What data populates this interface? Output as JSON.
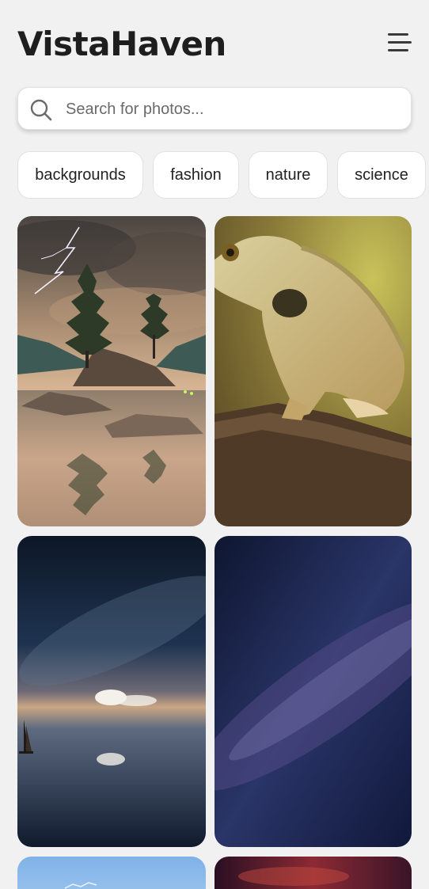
{
  "app": {
    "title": "VistaHaven",
    "menu_icon": "hamburger-menu-icon"
  },
  "search": {
    "placeholder": "Search for photos...",
    "value": "",
    "icon": "search-icon"
  },
  "categories": [
    "backgrounds",
    "fashion",
    "nature",
    "science"
  ],
  "gallery": {
    "photos": [
      {
        "subject": "lakeside trees with lightning"
      },
      {
        "subject": "lizard on a branch"
      },
      {
        "subject": "starry sky reflected over water with sailboat"
      },
      {
        "subject": "milky way night sky"
      },
      {
        "subject": "blue sky"
      },
      {
        "subject": "red nebula"
      }
    ]
  }
}
